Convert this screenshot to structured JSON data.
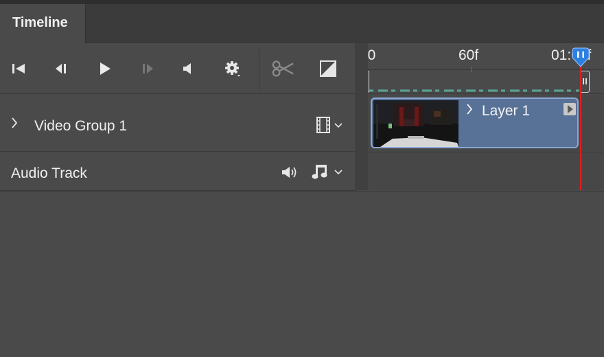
{
  "panel": {
    "tab_label": "Timeline"
  },
  "controls": {
    "icons": [
      "go-to-first-frame-icon",
      "previous-frame-icon",
      "play-icon",
      "next-frame-icon",
      "mute-audio-icon",
      "settings-gear-icon",
      "split-at-playhead-scissors-icon",
      "transition-icon"
    ]
  },
  "tracks": {
    "video_group": {
      "label": "Video Group 1",
      "icon": "film-strip-icon"
    },
    "audio_track": {
      "label": "Audio Track",
      "icons": [
        "speaker-icon",
        "music-note-icon"
      ]
    }
  },
  "ruler": {
    "ticks": [
      "00",
      "60f",
      "01:00f"
    ]
  },
  "clip": {
    "label": "Layer 1"
  },
  "colors": {
    "panel_bg": "#4a4a4a",
    "clip_fill": "#587297",
    "clip_border": "#8aa7d4",
    "playhead": "#2d7fe0",
    "playline": "#e02020",
    "work_area_dash": "#5aa595"
  }
}
